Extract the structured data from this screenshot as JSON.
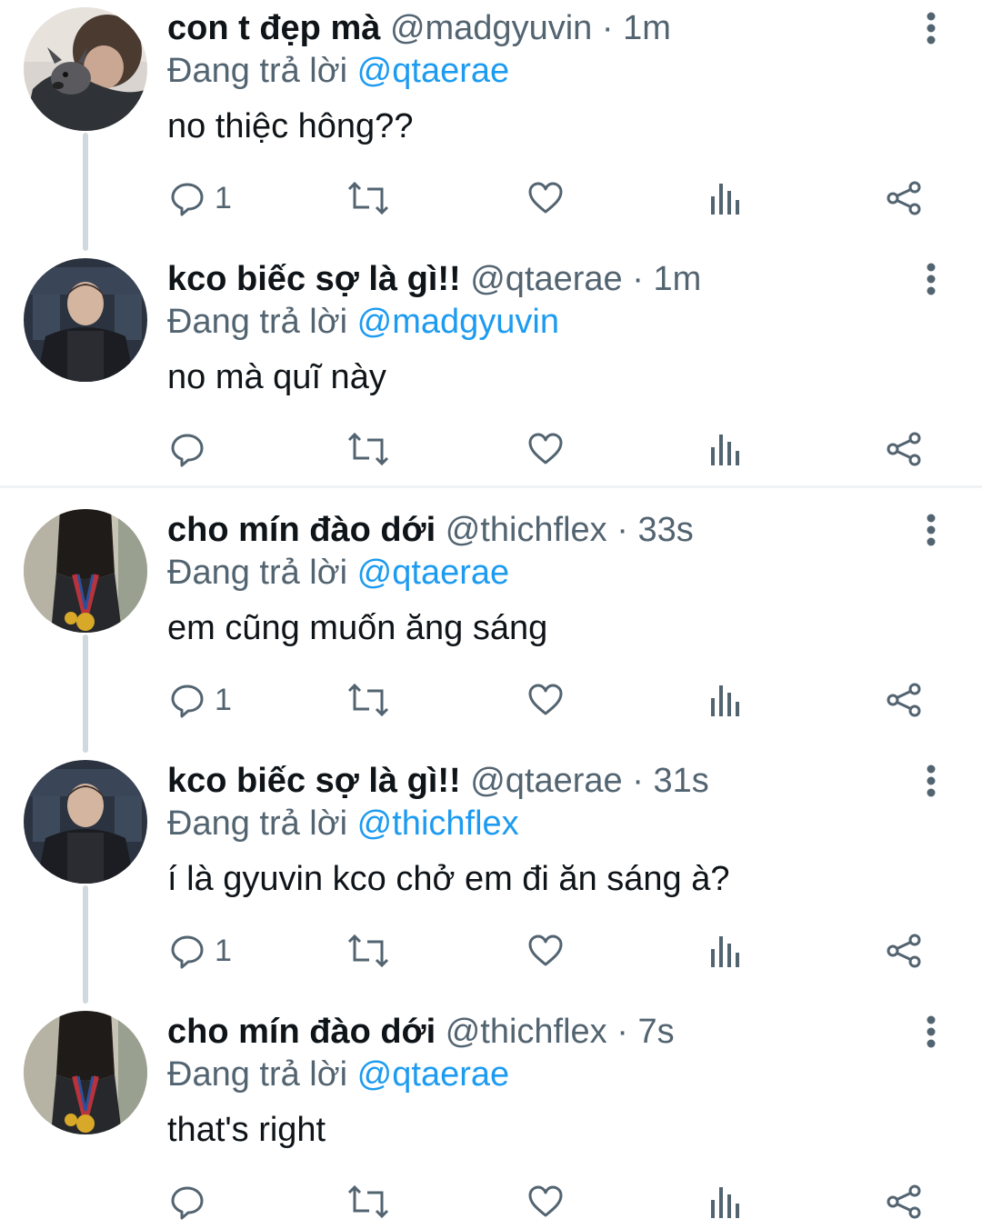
{
  "reply_prefix": "Đang trả lời",
  "accent_color": "#1d9bf0",
  "icons": {
    "more": "more-vertical-icon",
    "reply": "reply-icon",
    "retweet": "retweet-icon",
    "like": "like-icon",
    "views": "views-icon",
    "share": "share-icon"
  },
  "tweets": [
    {
      "name": "con t đẹp mà",
      "handle": "@madgyuvin",
      "sep": "·",
      "time": "1m",
      "reply_to": "@qtaerae",
      "text": "no thiệc hông??",
      "reply_count": "1",
      "avatar": "dog-avatar"
    },
    {
      "name": "kco biếc sợ là gì!!",
      "handle": "@qtaerae",
      "sep": "·",
      "time": "1m",
      "reply_to": "@madgyuvin",
      "text": "no mà quĩ này",
      "reply_count": "",
      "avatar": "dark-jacket-avatar"
    },
    {
      "name": "cho mín đào dới",
      "handle": "@thichflex",
      "sep": "·",
      "time": "33s",
      "reply_to": "@qtaerae",
      "text": "em cũng muốn ăng sáng",
      "reply_count": "1",
      "avatar": "medal-avatar"
    },
    {
      "name": "kco biếc sợ là gì!!",
      "handle": "@qtaerae",
      "sep": "·",
      "time": "31s",
      "reply_to": "@thichflex",
      "text": "í là gyuvin kco chở em đi ăn sáng à?",
      "reply_count": "1",
      "avatar": "dark-jacket-avatar"
    },
    {
      "name": "cho mín đào dới",
      "handle": "@thichflex",
      "sep": "·",
      "time": "7s",
      "reply_to": "@qtaerae",
      "text": "that's right",
      "reply_count": "",
      "avatar": "medal-avatar"
    }
  ]
}
